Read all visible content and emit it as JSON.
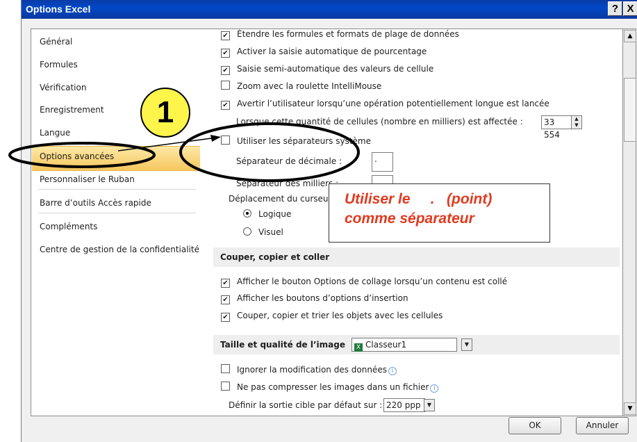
{
  "window": {
    "title": "Options Excel",
    "help_label": "?",
    "close_label": "X"
  },
  "nav": {
    "items": [
      {
        "label": "Général"
      },
      {
        "label": "Formules"
      },
      {
        "label": "Vérification"
      },
      {
        "label": "Enregistrement"
      },
      {
        "label": "Langue"
      },
      {
        "label": "Options avancées",
        "selected": true
      },
      {
        "label": "Personnaliser le Ruban"
      },
      {
        "label": "Barre d’outils Accès rapide"
      },
      {
        "label": "Compléments"
      },
      {
        "label": "Centre de gestion de la confidentialité"
      }
    ]
  },
  "options": {
    "extend_formulas": {
      "label": "Étendre les formules et formats de plage de données",
      "checked": true
    },
    "auto_percent": {
      "label": "Activer la saisie automatique de pourcentage",
      "checked": true
    },
    "semi_auto": {
      "label": "Saisie semi-automatique des valeurs de cellule",
      "checked": true
    },
    "zoom_roll": {
      "label": "Zoom avec la roulette IntelliMouse",
      "checked": false
    },
    "warn_long": {
      "label": "Avertir l’utilisateur lorsqu’une opération potentiellement longue est lancée",
      "checked": true
    },
    "cells_affected": {
      "label": "Lorsque cette quantité de cellules (nombre en milliers) est affectée :",
      "value": "33 554"
    },
    "system_separators": {
      "label": "Utiliser les séparateurs système",
      "checked": false
    },
    "decimal_separator": {
      "label": "Séparateur de décimale :",
      "value": "."
    },
    "thousands_separator": {
      "label": "Séparateur des milliers :",
      "value": ""
    },
    "cursor_movement": {
      "label": "Déplacement du curseur :"
    },
    "logical": {
      "label": "Logique",
      "selected": true
    },
    "visual": {
      "label": "Visuel",
      "selected": false
    }
  },
  "cut_copy": {
    "header": "Couper, copier et coller",
    "paste_options": {
      "label": "Afficher le bouton Options de collage lorsqu’un contenu est collé",
      "checked": true
    },
    "insert_options": {
      "label": "Afficher les boutons d’options d’insertion",
      "checked": true
    },
    "sort_objects": {
      "label": "Couper, copier et trier les objets avec les cellules",
      "checked": true
    }
  },
  "image": {
    "header": "Taille et qualité de l’image",
    "workbook": "Classeur1",
    "ignore_edits": {
      "label": "Ignorer la modification des données",
      "checked": false
    },
    "no_compress": {
      "label": "Ne pas compresser les images dans un fichier",
      "checked": false
    },
    "target_output": {
      "label": "Définir la sortie cible par défaut sur :",
      "value": "220 ppp"
    }
  },
  "buttons": {
    "ok": "OK",
    "cancel": "Annuler"
  },
  "annotation": {
    "line1": "Utiliser le     .   (point)",
    "line2": "comme séparateur",
    "badge": "1"
  },
  "colors": {
    "titlebar": "#0048c8",
    "selection": "#f6c75e",
    "annotation_text": "#e03a1e",
    "badge": "#fdf54a"
  }
}
